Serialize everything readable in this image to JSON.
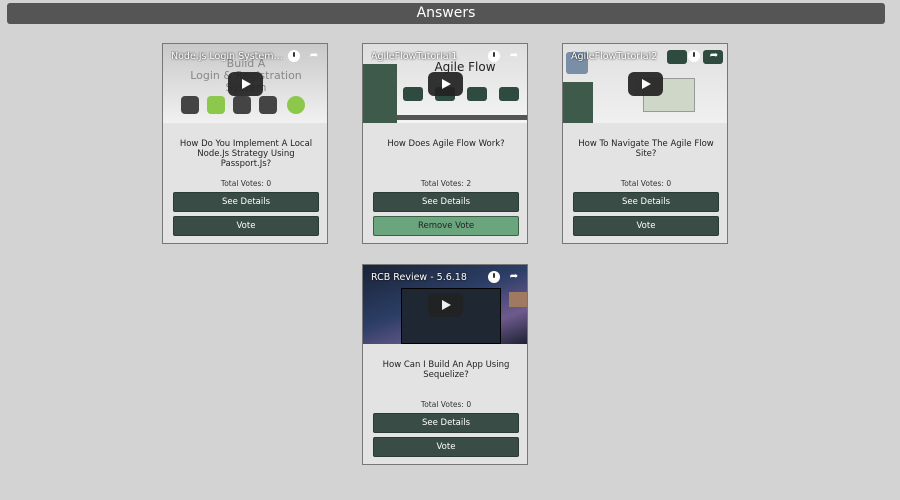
{
  "header": {
    "title": "Answers"
  },
  "cards": [
    {
      "video_title": "Node.js Login System Wit...",
      "thumb_text_line1": "Build A",
      "thumb_text_line2": "Login & Registration System",
      "question": "How Do You Implement A Local Node.Js Strategy Using Passport.Js?",
      "votes": "Total Votes: 0",
      "details_label": "See Details",
      "vote_label": "Vote",
      "voted": false
    },
    {
      "video_title": "AgileFlowTutorial1",
      "thumb_big_text": "Agile Flow",
      "question": "How Does Agile Flow Work?",
      "votes": "Total Votes: 2",
      "details_label": "See Details",
      "vote_label": "Remove Vote",
      "voted": true
    },
    {
      "video_title": "AgileFlowTutorial2",
      "question": "How To Navigate The Agile Flow Site?",
      "votes": "Total Votes: 0",
      "details_label": "See Details",
      "vote_label": "Vote",
      "voted": false
    },
    {
      "video_title": "RCB Review - 5.6.18",
      "question": "How Can I Build An App Using Sequelize?",
      "votes": "Total Votes: 0",
      "details_label": "See Details",
      "vote_label": "Vote",
      "voted": false
    }
  ],
  "colors": {
    "page_bg": "#d3d3d3",
    "header_bg": "#555555",
    "button_dark": "#3a4c46",
    "button_remove": "#6aa57e"
  },
  "icons": [
    "play-icon",
    "watch-later-icon",
    "share-icon"
  ]
}
